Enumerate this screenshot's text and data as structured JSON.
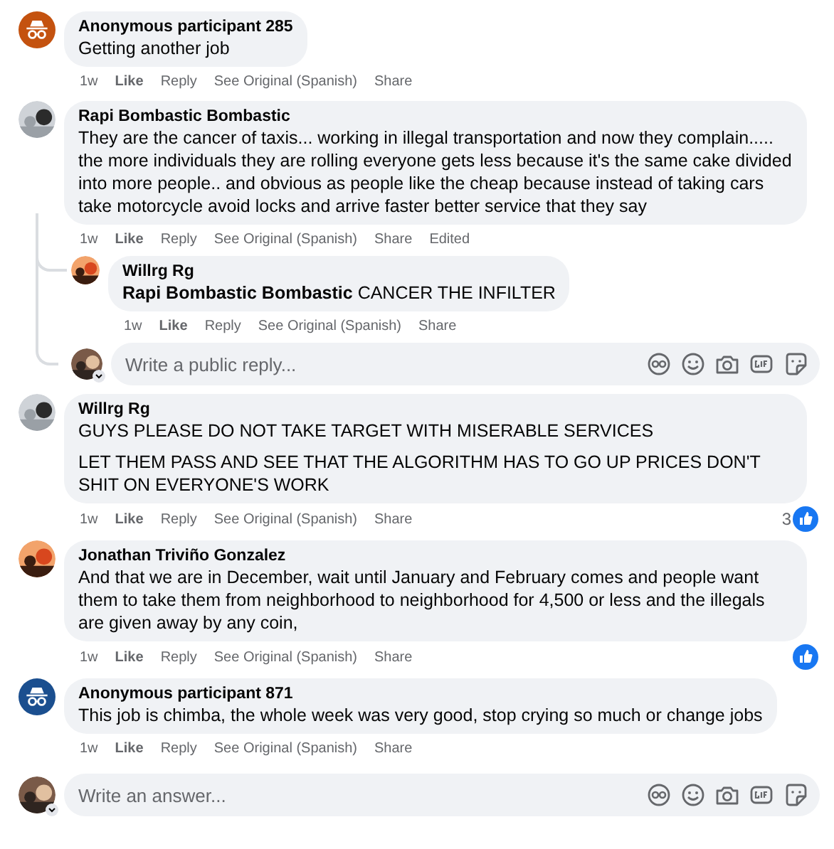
{
  "comments": [
    {
      "author": "Anonymous participant 285",
      "avatar": {
        "kind": "anonymous",
        "color": "#c4520f"
      },
      "paragraphs": [
        "Getting another job"
      ],
      "actions": [
        "1w",
        "Like",
        "Reply",
        "See Original (Spanish)",
        "Share"
      ]
    },
    {
      "author": "Rapi Bombastic Bombastic",
      "avatar": {
        "kind": "picture"
      },
      "paragraphs": [
        "They are the cancer of taxis... working in illegal transportation and now they complain..... the more individuals they are rolling everyone gets less because it's the same cake divided into more people.. and obvious as people like the cheap because instead of taking cars take motorcycle avoid locks and arrive faster better service that they say"
      ],
      "actions": [
        "1w",
        "Like",
        "Reply",
        "See Original (Spanish)",
        "Share",
        "Edited"
      ],
      "replies": [
        {
          "author": "Willrg Rg",
          "avatar": {
            "kind": "picture"
          },
          "paragraphs": [
            "**Rapi Bombastic Bombastic** CANCER THE INFILTER"
          ],
          "actions": [
            "1w",
            "Like",
            "Reply",
            "See Original (Spanish)",
            "Share"
          ]
        }
      ],
      "reply_field": {
        "placeholder": "Write a public reply..."
      }
    },
    {
      "author": "Willrg Rg",
      "avatar": {
        "kind": "picture"
      },
      "paragraphs": [
        "GUYS PLEASE DO NOT TAKE TARGET WITH MISERABLE SERVICES",
        "LET THEM PASS AND SEE THAT THE ALGORITHM HAS TO GO UP PRICES DON'T SHIT ON EVERYONE'S WORK"
      ],
      "actions": [
        "1w",
        "Like",
        "Reply",
        "See Original (Spanish)",
        "Share"
      ],
      "reactions": {
        "kind": "like",
        "count": "3"
      }
    },
    {
      "author": "Jonathan Triviño Gonzalez",
      "avatar": {
        "kind": "picture"
      },
      "paragraphs": [
        "And that we are in December, wait until January and February comes and people want them to take them from neighborhood to neighborhood for 4,500 or less and the illegals are given away by any coin,"
      ],
      "actions": [
        "1w",
        "Like",
        "Reply",
        "See Original (Spanish)",
        "Share"
      ],
      "reactions": {
        "kind": "like"
      }
    },
    {
      "author": "Anonymous participant 871",
      "avatar": {
        "kind": "anonymous",
        "color": "#1b4f8f"
      },
      "paragraphs": [
        "This job is chimba, the whole week was very good, stop crying so much or change jobs"
      ],
      "actions": [
        "1w",
        "Like",
        "Reply",
        "See Original (Spanish)",
        "Share"
      ]
    }
  ],
  "answer_field": {
    "placeholder": "Write an answer..."
  }
}
